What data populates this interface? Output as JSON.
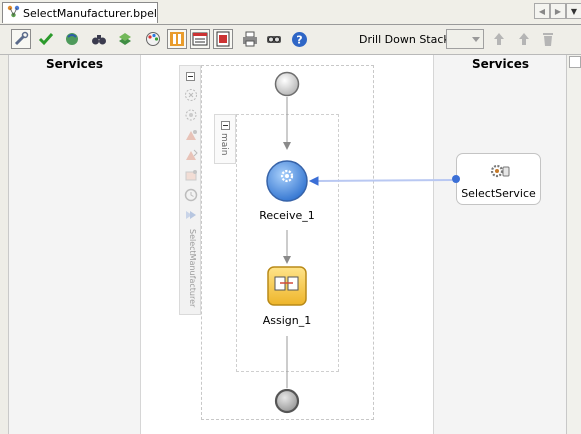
{
  "tab": {
    "title": "SelectManufacturer.bpel",
    "icon": "bpel-process-icon"
  },
  "toolbar": {
    "drill_label": "Drill Down Stack:",
    "drill_value": "",
    "buttons": [
      "design-tools-icon",
      "validate-check-icon",
      "refresh-globe-icon",
      "find-binoculars-icon",
      "layers-icon",
      "palette-icon",
      "zoom-frame-icon",
      "table-view-icon",
      "page-view-icon",
      "print-icon",
      "print-preview-icon",
      "help-icon"
    ]
  },
  "services": {
    "left_title": "Services",
    "right_title": "Services"
  },
  "process": {
    "name": "SelectManufacturer",
    "scope_label": "main"
  },
  "activities": {
    "receive_label": "Receive_1",
    "assign_label": "Assign_1"
  },
  "partner_link": {
    "label": "SelectService"
  },
  "colors": {
    "receive_fill": "#4a8ee0",
    "assign_fill": "#f3c94a",
    "link_line": "#7c9cf0"
  }
}
